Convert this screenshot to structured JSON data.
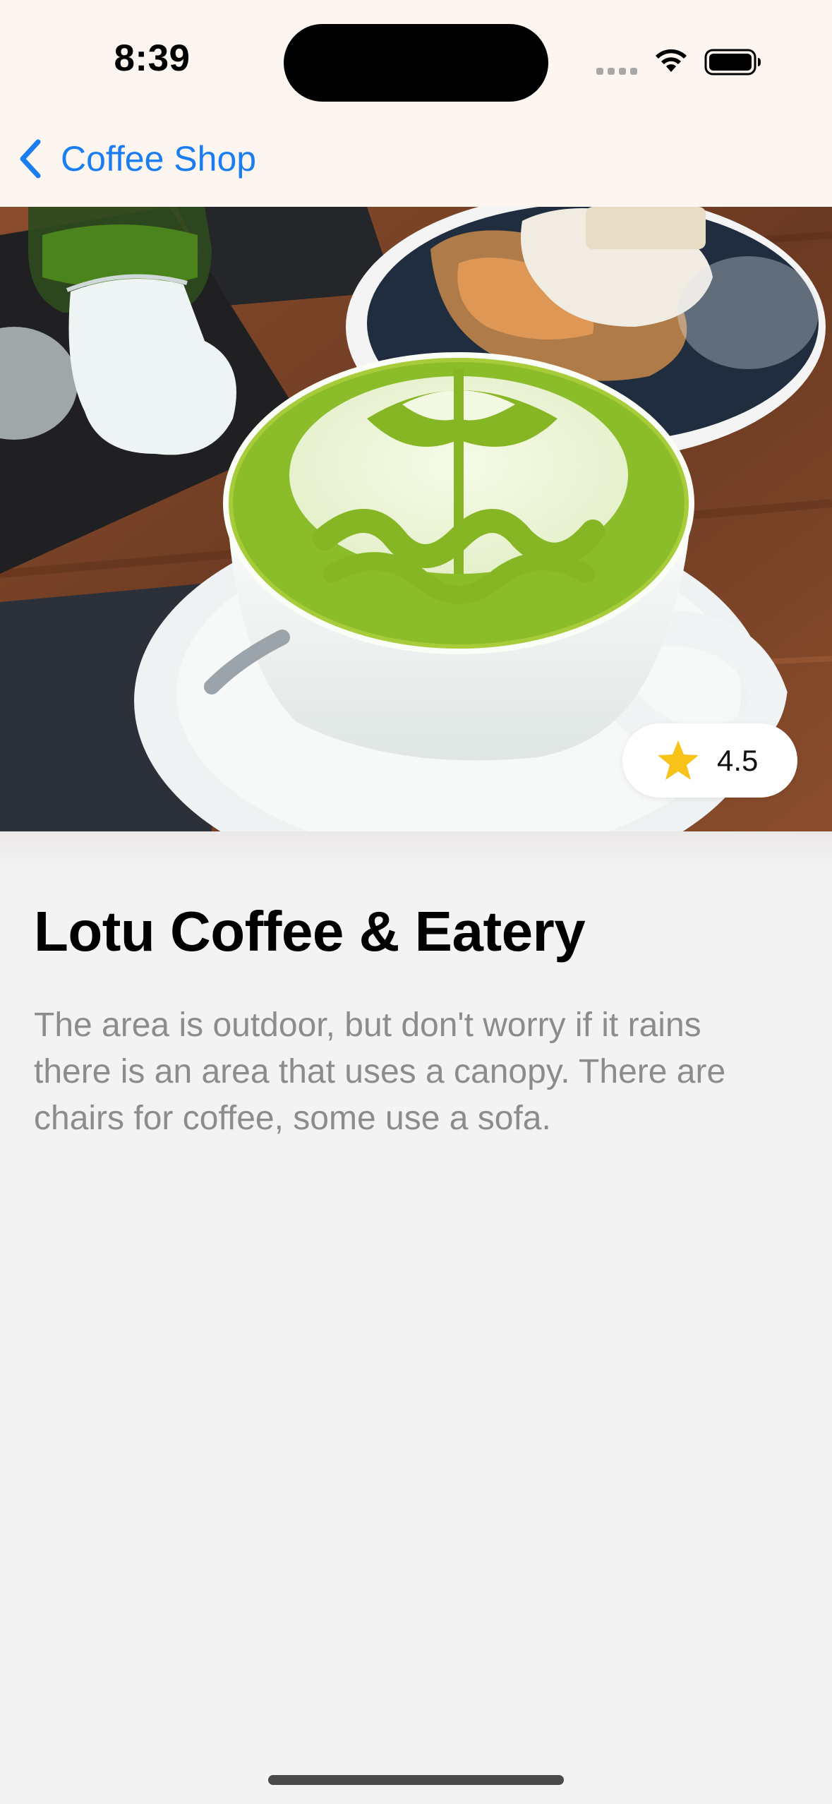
{
  "status_bar": {
    "time": "8:39"
  },
  "nav": {
    "back_label": "Coffee Shop"
  },
  "shop": {
    "rating": "4.5",
    "name": "Lotu Coffee & Eatery",
    "description": "The area is outdoor, but don't worry if it rains there is an area that uses a canopy. There are chairs for coffee, some use a sofa."
  },
  "icons": {
    "back": "chevron-left-icon",
    "star": "star-icon",
    "wifi": "wifi-icon",
    "battery": "battery-icon",
    "signal": "cellular-signal-icon"
  },
  "colors": {
    "accent": "#1a7ef2",
    "star": "#f7c21a",
    "matcha": "#8cc63f",
    "header_bg": "#fdf5ef",
    "page_bg": "#f3f3f3"
  }
}
